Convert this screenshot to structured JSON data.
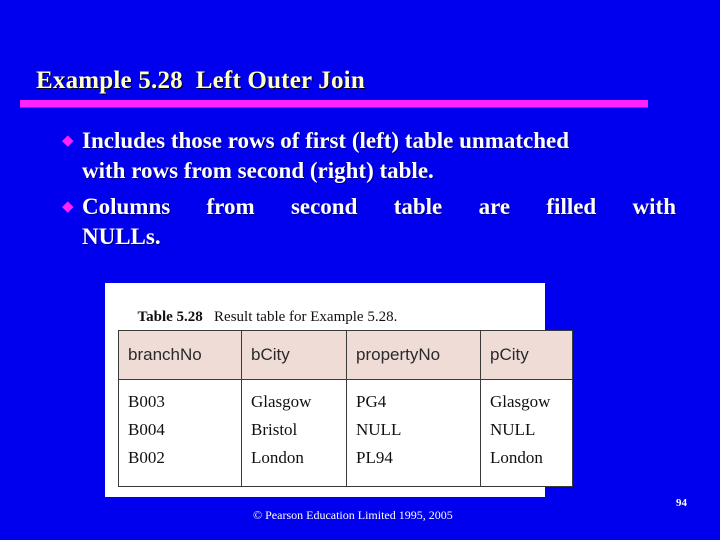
{
  "slide": {
    "background_color": "#0000EE",
    "title": "Example 5.28  Left Outer Join",
    "title_color": "#FFFFCC",
    "rule_color": "#FF22FF",
    "bullet_marker": "◆",
    "bullet_color": "#FF22FF"
  },
  "bullets": [
    {
      "line1": "Includes those rows of first (left) table unmatched",
      "line2": "with rows from second (right) table."
    },
    {
      "line1": "Columns from second table are filled with",
      "line2": "NULLs."
    }
  ],
  "figure": {
    "caption_label": "Table 5.28",
    "caption_text": "   Result table for Example 5.28.",
    "header_background": "#EFDCD6",
    "columns": [
      "branchNo",
      "bCity",
      "propertyNo",
      "pCity"
    ],
    "rows": [
      [
        "B003",
        "Glasgow",
        "PG4",
        "Glasgow"
      ],
      [
        "B004",
        "Bristol",
        "NULL",
        "NULL"
      ],
      [
        "B002",
        "London",
        "PL94",
        "London"
      ]
    ]
  },
  "footer": {
    "copyright": "© Pearson Education Limited 1995, 2005",
    "page_number": "94"
  }
}
